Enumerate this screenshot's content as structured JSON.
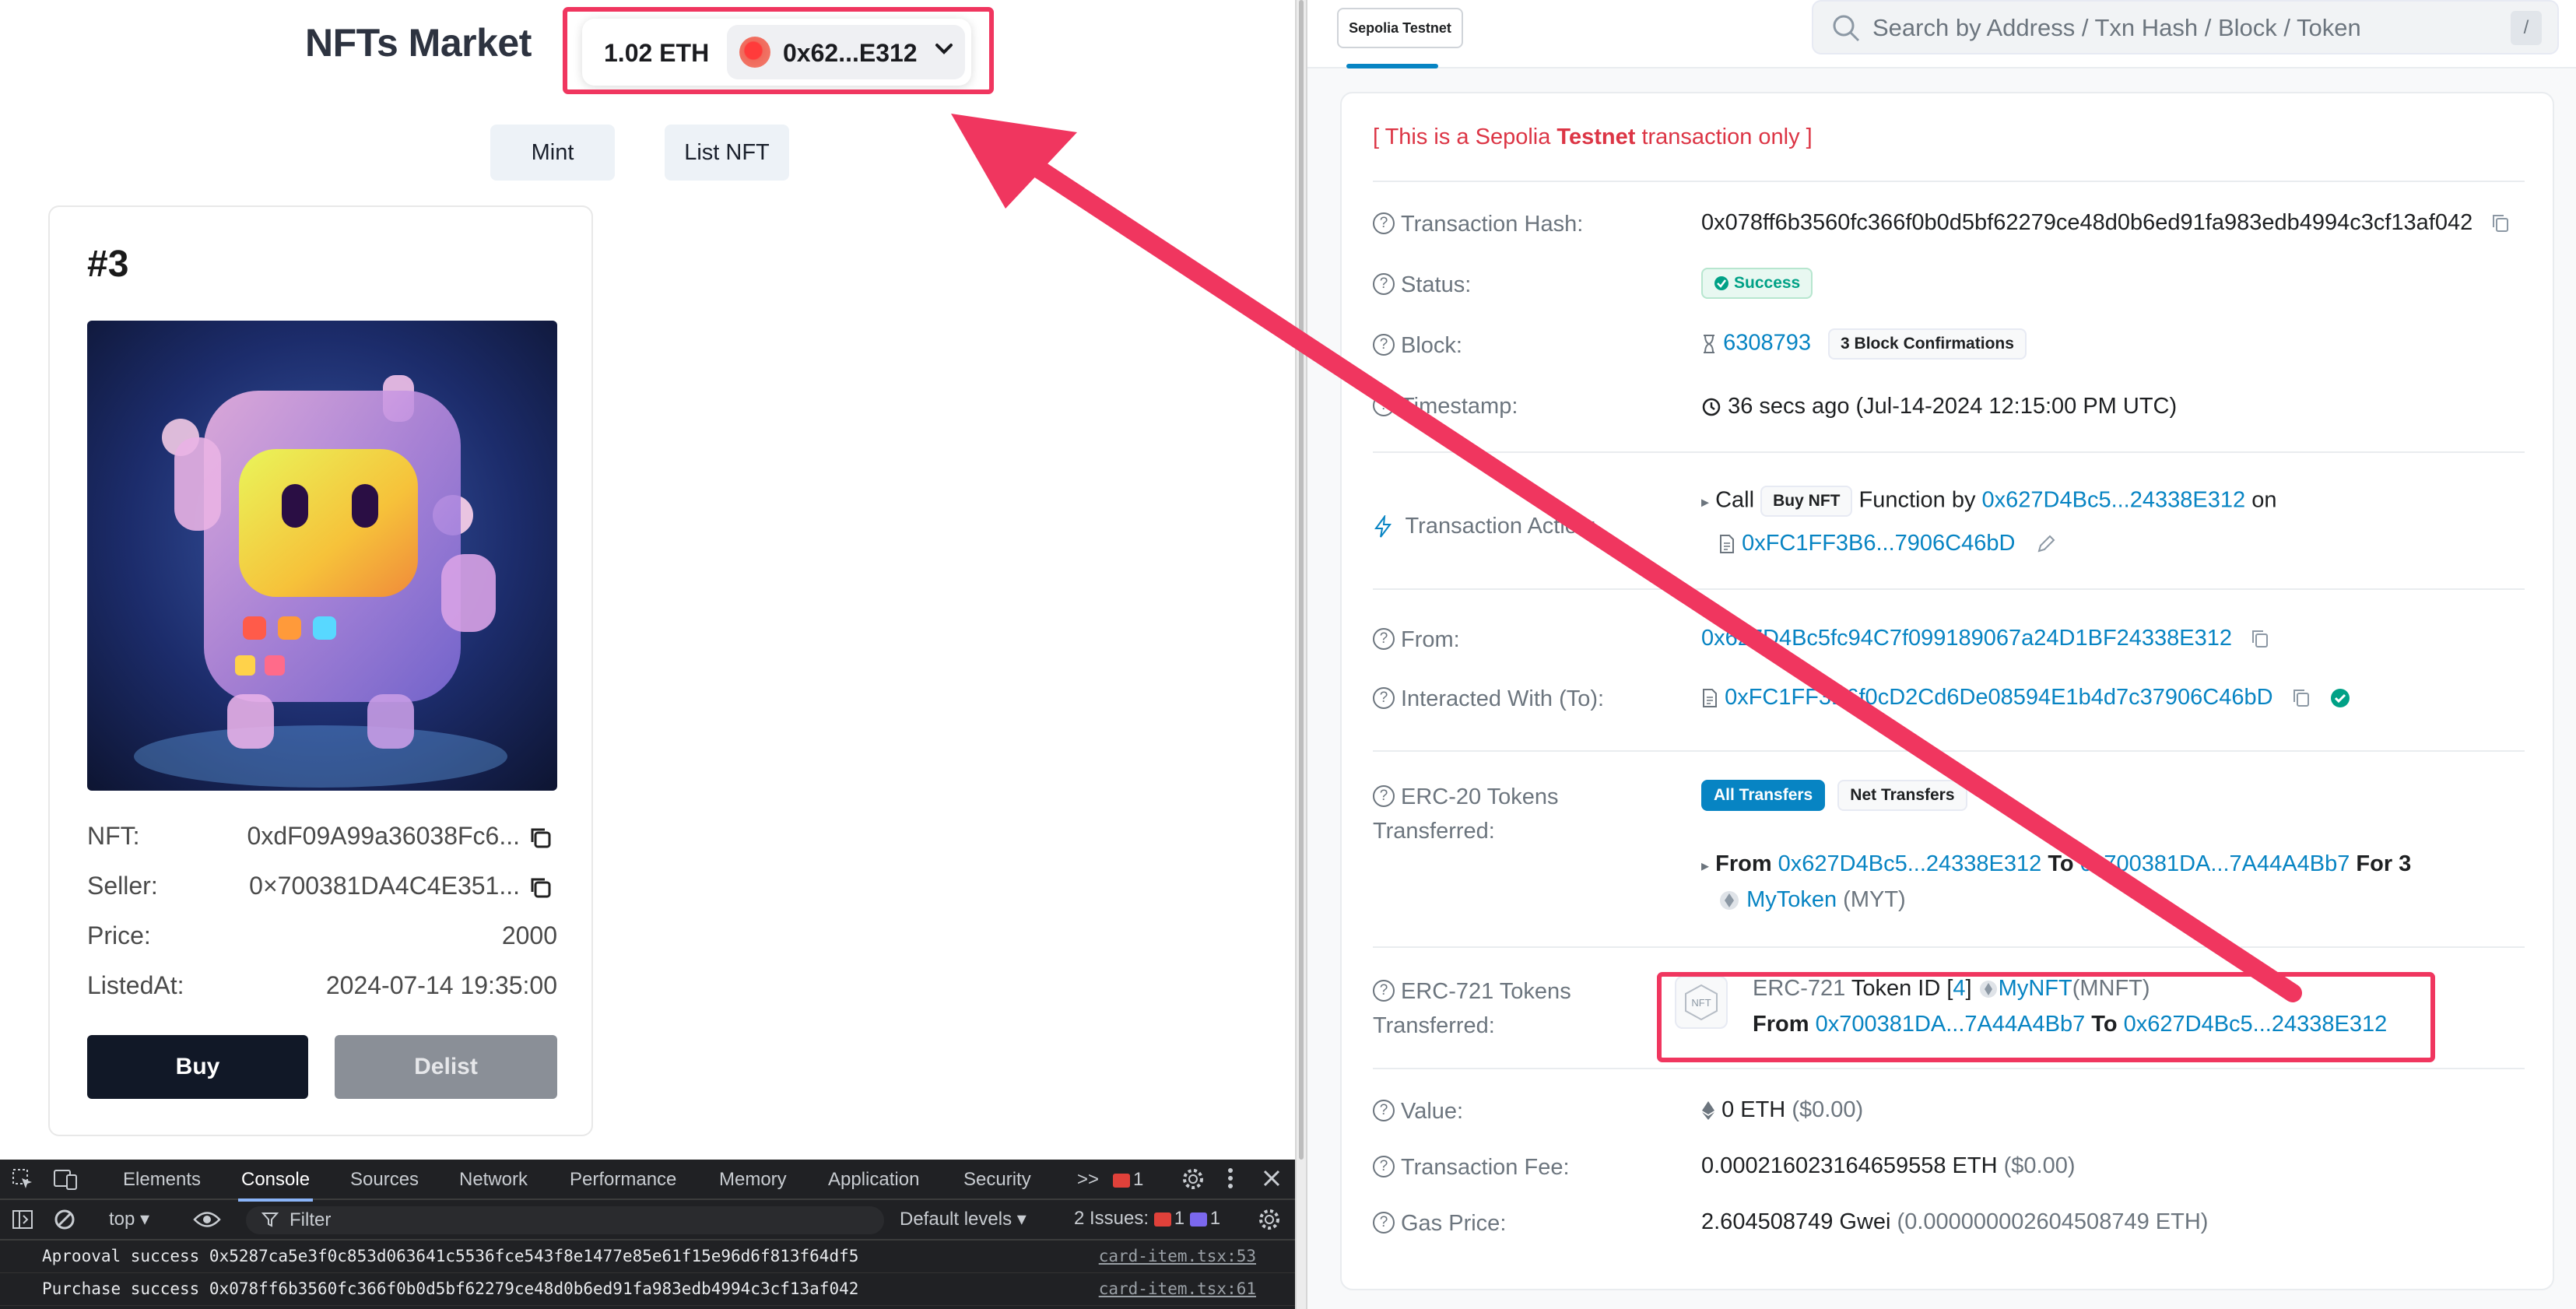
{
  "left": {
    "title": "NFTs Market",
    "wallet": {
      "balance": "1.02 ETH",
      "address": "0x62...E312"
    },
    "mint_label": "Mint",
    "list_label": "List NFT",
    "card": {
      "number": "#3",
      "rows": [
        {
          "key": "NFT:",
          "value": "0xdF09A99a36038Fc6..."
        },
        {
          "key": "Seller:",
          "value": "0×700381DA4C4E351..."
        },
        {
          "key": "Price:",
          "value": "2000"
        },
        {
          "key": "ListedAt:",
          "value": "2024-07-14 19:35:00"
        }
      ],
      "buy_label": "Buy",
      "delist_label": "Delist"
    }
  },
  "devtools": {
    "tabs": [
      "Elements",
      "Console",
      "Sources",
      "Network",
      "Performance",
      "Memory",
      "Application",
      "Security"
    ],
    "active_tab": "Console",
    "more": ">>",
    "error_count": "1",
    "context": "top",
    "filter_placeholder": "Filter",
    "levels": "Default levels",
    "issues_label": "2 Issues:",
    "issues_red": "1",
    "issues_blue": "1",
    "logs": [
      {
        "message": "Aprooval success 0x5287ca5e3f0c853d063641c5536fce543f8e1477e85e61f15e96d6f813f64df5",
        "source": "card-item.tsx:53"
      },
      {
        "message": "Purchase success 0x078ff6b3560fc366f0b0d5bf62279ce48d0b6ed91fa983edb4994c3cf13af042",
        "source": "card-item.tsx:61"
      }
    ]
  },
  "right": {
    "network": "Sepolia Testnet",
    "search_placeholder": "Search by Address / Txn Hash / Block / Token",
    "search_key": "/",
    "notice_prefix": "[ This is a Sepolia ",
    "notice_bold": "Testnet",
    "notice_suffix": " transaction only ]",
    "tx_hash_label": "Transaction Hash:",
    "tx_hash": "0x078ff6b3560fc366f0b0d5bf62279ce48d0b6ed91fa983edb4994c3cf13af042",
    "status_label": "Status:",
    "status": "Success",
    "block_label": "Block:",
    "block": "6308793",
    "confirmations": "3 Block Confirmations",
    "timestamp_label": "Timestamp:",
    "timestamp": "36 secs ago (Jul-14-2024 12:15:00 PM UTC)",
    "action_label": "Transaction Action:",
    "action_call": "Call",
    "action_method": "Buy NFT",
    "action_function_by": "Function by",
    "action_from": "0x627D4Bc5...24338E312",
    "action_on": "on",
    "action_contract": "0xFC1FF3B6...7906C46bD",
    "from_label": "From:",
    "from": "0x627D4Bc5fc94C7f099189067a24D1BF24338E312",
    "to_label": "Interacted With (To):",
    "to": "0xFC1FF3B6f0cD2Cd6De08594E1b4d7c37906C46bD",
    "erc20_label_1": "ERC-20 Tokens",
    "erc20_label_2": "Transferred:",
    "all_transfers": "All Transfers",
    "net_transfers": "Net Transfers",
    "erc20_from_word": "From",
    "erc20_from": "0x627D4Bc5...24338E312",
    "erc20_to_word": "To",
    "erc20_to": "0x700381DA...7A44A4Bb7",
    "erc20_for": "For 3",
    "erc20_token": "MyToken",
    "erc20_symbol": "(MYT)",
    "erc721_label_1": "ERC-721 Tokens",
    "erc721_label_2": "Transferred:",
    "erc721_type": "ERC-721",
    "erc721_token_id_text": "Token ID [",
    "erc721_token_id": "4",
    "erc721_token_id_close": "]",
    "erc721_name": "MyNFT",
    "erc721_symbol": "(MNFT)",
    "erc721_from_word": "From",
    "erc721_from": "0x700381DA...7A44A4Bb7",
    "erc721_to_word": "To",
    "erc721_to": "0x627D4Bc5...24338E312",
    "nft_icon_text": "NFT",
    "value_label": "Value:",
    "value": "0 ETH",
    "value_usd": "($0.00)",
    "fee_label": "Transaction Fee:",
    "fee": "0.000216023164659558 ETH",
    "fee_usd": "($0.00)",
    "gas_label": "Gas Price:",
    "gas": "2.604508749 Gwei",
    "gas_eth": "(0.000000002604508749 ETH)"
  },
  "colors": {
    "annotation": "#f0365f",
    "link": "#0784c3",
    "success": "#00a186"
  }
}
